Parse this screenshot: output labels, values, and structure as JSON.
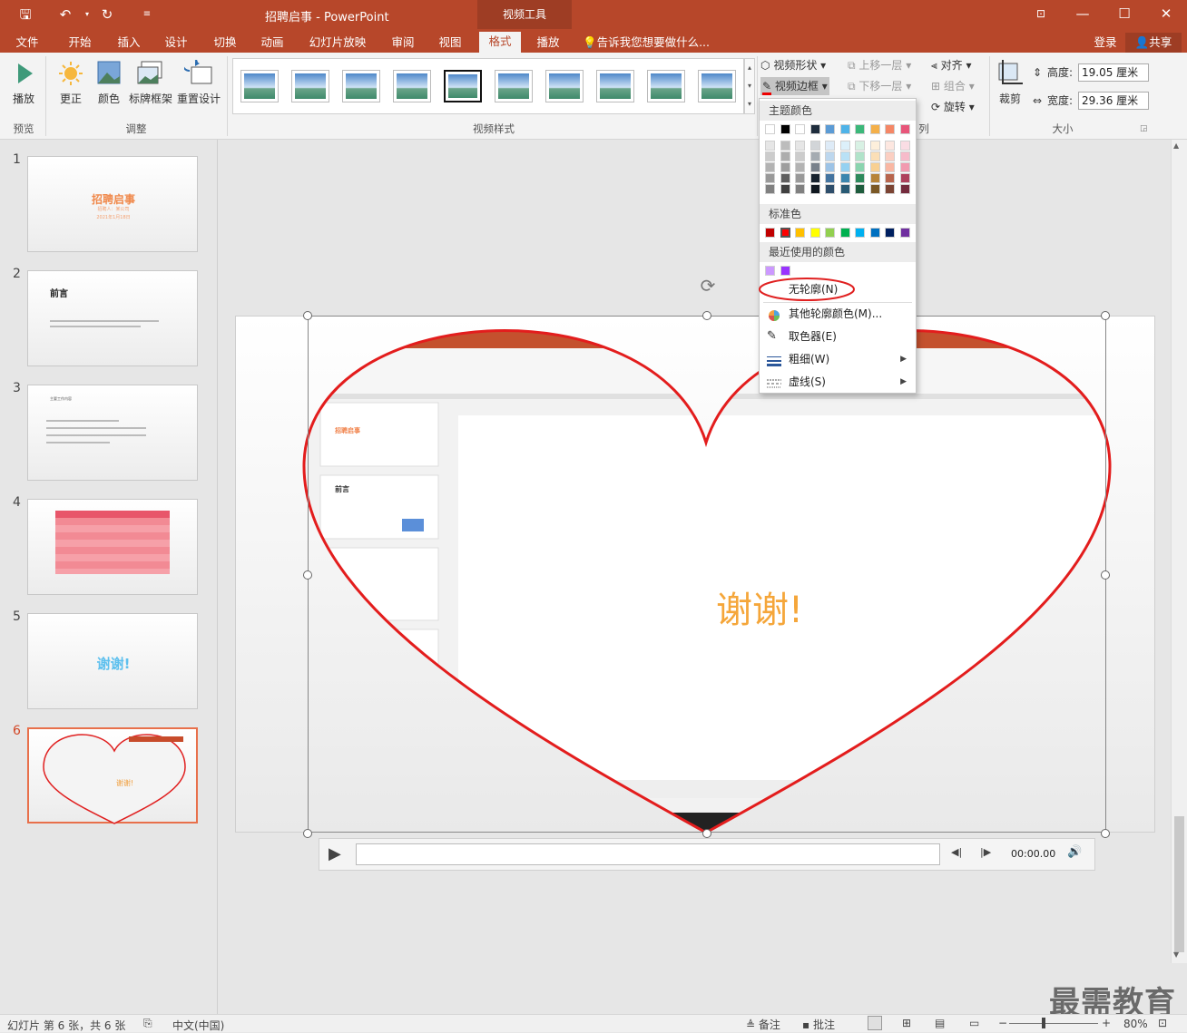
{
  "window": {
    "title": "招聘启事 - PowerPoint",
    "context_tab_title": "视频工具"
  },
  "tabs": [
    "文件",
    "开始",
    "插入",
    "设计",
    "切换",
    "动画",
    "幻灯片放映",
    "审阅",
    "视图",
    "格式",
    "播放"
  ],
  "active_tab": "格式",
  "tellme": "告诉我您想要做什么...",
  "login": "登录",
  "share": "共享",
  "ribbon": {
    "play": "播放",
    "correct": "更正",
    "color": "颜色",
    "poster_frame": "标牌框架",
    "reset_design": "重置设计",
    "group_preview": "预览",
    "group_adjust": "调整",
    "group_video_styles": "视频样式",
    "video_shape": "视频形状",
    "video_border": "视频边框",
    "bring_forward": "上移一层",
    "send_backward": "下移一层",
    "align": "对齐",
    "group_obj": "组合",
    "rotate": "旋转",
    "arrange_label_tail": "列",
    "crop": "裁剪",
    "height_label": "高度:",
    "height_value": "19.05 厘米",
    "width_label": "宽度:",
    "width_value": "29.36 厘米",
    "group_size": "大小"
  },
  "dropdown": {
    "theme_colors": "主题颜色",
    "standard_colors": "标准色",
    "recent_colors": "最近使用的颜色",
    "no_outline": "无轮廓(N)",
    "more_colors": "其他轮廓颜色(M)...",
    "eyedropper": "取色器(E)",
    "weight": "粗细(W)",
    "dashes": "虚线(S)",
    "theme_top_row": [
      "#ffffff",
      "#000000",
      "#ffffff",
      "#1f2d3d",
      "#5b9bd5",
      "#4fb3e8",
      "#3cb87a",
      "#f4b04a",
      "#f58766",
      "#e8567a"
    ],
    "standard_row": [
      "#c00000",
      "#ff0000",
      "#ffc000",
      "#ffff00",
      "#92d050",
      "#00b050",
      "#00b0f0",
      "#0070c0",
      "#002060",
      "#7030a0"
    ],
    "recent_row": [
      "#cc99ff",
      "#9933ff"
    ]
  },
  "slides": [
    {
      "num": "1",
      "title": "招聘启事",
      "sub1": "招聘人：某公司",
      "sub2": "2021年1月18日"
    },
    {
      "num": "2",
      "title": "前言"
    },
    {
      "num": "3",
      "title": "主要工作内容"
    },
    {
      "num": "4"
    },
    {
      "num": "5",
      "title": "谢谢!"
    },
    {
      "num": "6",
      "title": "谢谢!"
    }
  ],
  "video": {
    "inner_text": "谢谢!",
    "inner_slide2_title": "前言",
    "inner_slide1_title": "招聘启事",
    "time": "00:00.00"
  },
  "status": {
    "slide_info": "幻灯片 第 6 张，共 6 张",
    "language": "中文(中国)",
    "notes": "备注",
    "comments": "批注",
    "zoom": "80%"
  },
  "watermark": "最需教育"
}
